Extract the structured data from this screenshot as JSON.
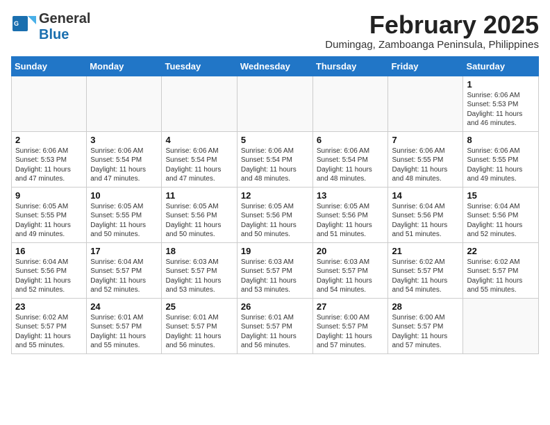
{
  "header": {
    "logo_general": "General",
    "logo_blue": "Blue",
    "month": "February 2025",
    "location": "Dumingag, Zamboanga Peninsula, Philippines"
  },
  "weekdays": [
    "Sunday",
    "Monday",
    "Tuesday",
    "Wednesday",
    "Thursday",
    "Friday",
    "Saturday"
  ],
  "weeks": [
    [
      {
        "day": "",
        "info": ""
      },
      {
        "day": "",
        "info": ""
      },
      {
        "day": "",
        "info": ""
      },
      {
        "day": "",
        "info": ""
      },
      {
        "day": "",
        "info": ""
      },
      {
        "day": "",
        "info": ""
      },
      {
        "day": "1",
        "info": "Sunrise: 6:06 AM\nSunset: 5:53 PM\nDaylight: 11 hours and 46 minutes."
      }
    ],
    [
      {
        "day": "2",
        "info": "Sunrise: 6:06 AM\nSunset: 5:53 PM\nDaylight: 11 hours and 47 minutes."
      },
      {
        "day": "3",
        "info": "Sunrise: 6:06 AM\nSunset: 5:54 PM\nDaylight: 11 hours and 47 minutes."
      },
      {
        "day": "4",
        "info": "Sunrise: 6:06 AM\nSunset: 5:54 PM\nDaylight: 11 hours and 47 minutes."
      },
      {
        "day": "5",
        "info": "Sunrise: 6:06 AM\nSunset: 5:54 PM\nDaylight: 11 hours and 48 minutes."
      },
      {
        "day": "6",
        "info": "Sunrise: 6:06 AM\nSunset: 5:54 PM\nDaylight: 11 hours and 48 minutes."
      },
      {
        "day": "7",
        "info": "Sunrise: 6:06 AM\nSunset: 5:55 PM\nDaylight: 11 hours and 48 minutes."
      },
      {
        "day": "8",
        "info": "Sunrise: 6:06 AM\nSunset: 5:55 PM\nDaylight: 11 hours and 49 minutes."
      }
    ],
    [
      {
        "day": "9",
        "info": "Sunrise: 6:05 AM\nSunset: 5:55 PM\nDaylight: 11 hours and 49 minutes."
      },
      {
        "day": "10",
        "info": "Sunrise: 6:05 AM\nSunset: 5:55 PM\nDaylight: 11 hours and 50 minutes."
      },
      {
        "day": "11",
        "info": "Sunrise: 6:05 AM\nSunset: 5:56 PM\nDaylight: 11 hours and 50 minutes."
      },
      {
        "day": "12",
        "info": "Sunrise: 6:05 AM\nSunset: 5:56 PM\nDaylight: 11 hours and 50 minutes."
      },
      {
        "day": "13",
        "info": "Sunrise: 6:05 AM\nSunset: 5:56 PM\nDaylight: 11 hours and 51 minutes."
      },
      {
        "day": "14",
        "info": "Sunrise: 6:04 AM\nSunset: 5:56 PM\nDaylight: 11 hours and 51 minutes."
      },
      {
        "day": "15",
        "info": "Sunrise: 6:04 AM\nSunset: 5:56 PM\nDaylight: 11 hours and 52 minutes."
      }
    ],
    [
      {
        "day": "16",
        "info": "Sunrise: 6:04 AM\nSunset: 5:56 PM\nDaylight: 11 hours and 52 minutes."
      },
      {
        "day": "17",
        "info": "Sunrise: 6:04 AM\nSunset: 5:57 PM\nDaylight: 11 hours and 52 minutes."
      },
      {
        "day": "18",
        "info": "Sunrise: 6:03 AM\nSunset: 5:57 PM\nDaylight: 11 hours and 53 minutes."
      },
      {
        "day": "19",
        "info": "Sunrise: 6:03 AM\nSunset: 5:57 PM\nDaylight: 11 hours and 53 minutes."
      },
      {
        "day": "20",
        "info": "Sunrise: 6:03 AM\nSunset: 5:57 PM\nDaylight: 11 hours and 54 minutes."
      },
      {
        "day": "21",
        "info": "Sunrise: 6:02 AM\nSunset: 5:57 PM\nDaylight: 11 hours and 54 minutes."
      },
      {
        "day": "22",
        "info": "Sunrise: 6:02 AM\nSunset: 5:57 PM\nDaylight: 11 hours and 55 minutes."
      }
    ],
    [
      {
        "day": "23",
        "info": "Sunrise: 6:02 AM\nSunset: 5:57 PM\nDaylight: 11 hours and 55 minutes."
      },
      {
        "day": "24",
        "info": "Sunrise: 6:01 AM\nSunset: 5:57 PM\nDaylight: 11 hours and 55 minutes."
      },
      {
        "day": "25",
        "info": "Sunrise: 6:01 AM\nSunset: 5:57 PM\nDaylight: 11 hours and 56 minutes."
      },
      {
        "day": "26",
        "info": "Sunrise: 6:01 AM\nSunset: 5:57 PM\nDaylight: 11 hours and 56 minutes."
      },
      {
        "day": "27",
        "info": "Sunrise: 6:00 AM\nSunset: 5:57 PM\nDaylight: 11 hours and 57 minutes."
      },
      {
        "day": "28",
        "info": "Sunrise: 6:00 AM\nSunset: 5:57 PM\nDaylight: 11 hours and 57 minutes."
      },
      {
        "day": "",
        "info": ""
      }
    ]
  ]
}
